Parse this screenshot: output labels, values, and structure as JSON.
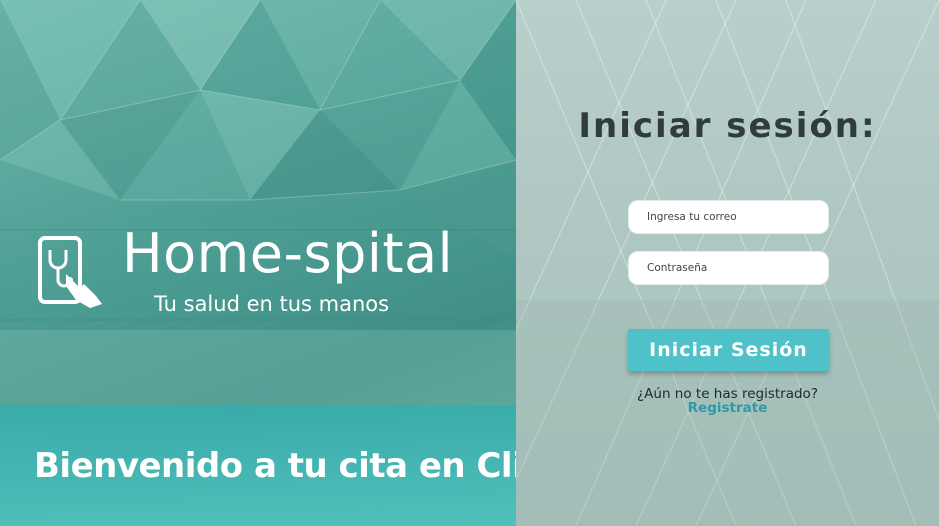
{
  "brand": {
    "name": "Home-spital",
    "tagline": "Tu salud en tus manos",
    "logo_icon": "hand-touching-tablet-stethoscope-icon"
  },
  "welcome": {
    "text": "Bienvenido a tu cita en Clivi"
  },
  "login": {
    "title": "Iniciar sesión:",
    "email_placeholder": "Ingresa tu correo",
    "password_placeholder": "Contraseña",
    "submit_label": "Iniciar Sesión",
    "register_prompt": "¿Aún no te has registrado?",
    "register_link": "Registrate"
  },
  "colors": {
    "accent": "#4fc1c9",
    "link": "#2f9aa6",
    "title_text": "#2f3b3c",
    "left_tint": "#4e9f95",
    "right_tint": "#aec7c2"
  }
}
